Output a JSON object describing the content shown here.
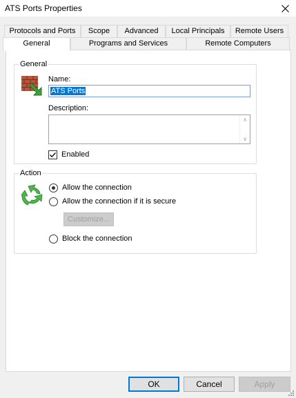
{
  "window": {
    "title": "ATS Ports Properties"
  },
  "tabs": {
    "row1": [
      "Protocols and Ports",
      "Scope",
      "Advanced",
      "Local Principals",
      "Remote Users"
    ],
    "row2": [
      "General",
      "Programs and Services",
      "Remote Computers"
    ],
    "active": "General"
  },
  "general": {
    "legend": "General",
    "name_label": "Name:",
    "name_value": "ATS Ports",
    "description_label": "Description:",
    "description_value": "",
    "enabled_label": "Enabled",
    "enabled_checked": true,
    "icon": "firewall-rule-icon"
  },
  "action": {
    "legend": "Action",
    "icon": "refresh-arrows-icon",
    "options": [
      {
        "label": "Allow the connection",
        "checked": true
      },
      {
        "label": "Allow the connection if it is secure",
        "checked": false
      },
      {
        "label": "Block the connection",
        "checked": false
      }
    ],
    "customize_label": "Customize..."
  },
  "buttons": {
    "ok": "OK",
    "cancel": "Cancel",
    "apply": "Apply"
  },
  "colors": {
    "accent": "#0078d7",
    "arrow_green": "#4caf50",
    "brick": "#a0522d"
  }
}
